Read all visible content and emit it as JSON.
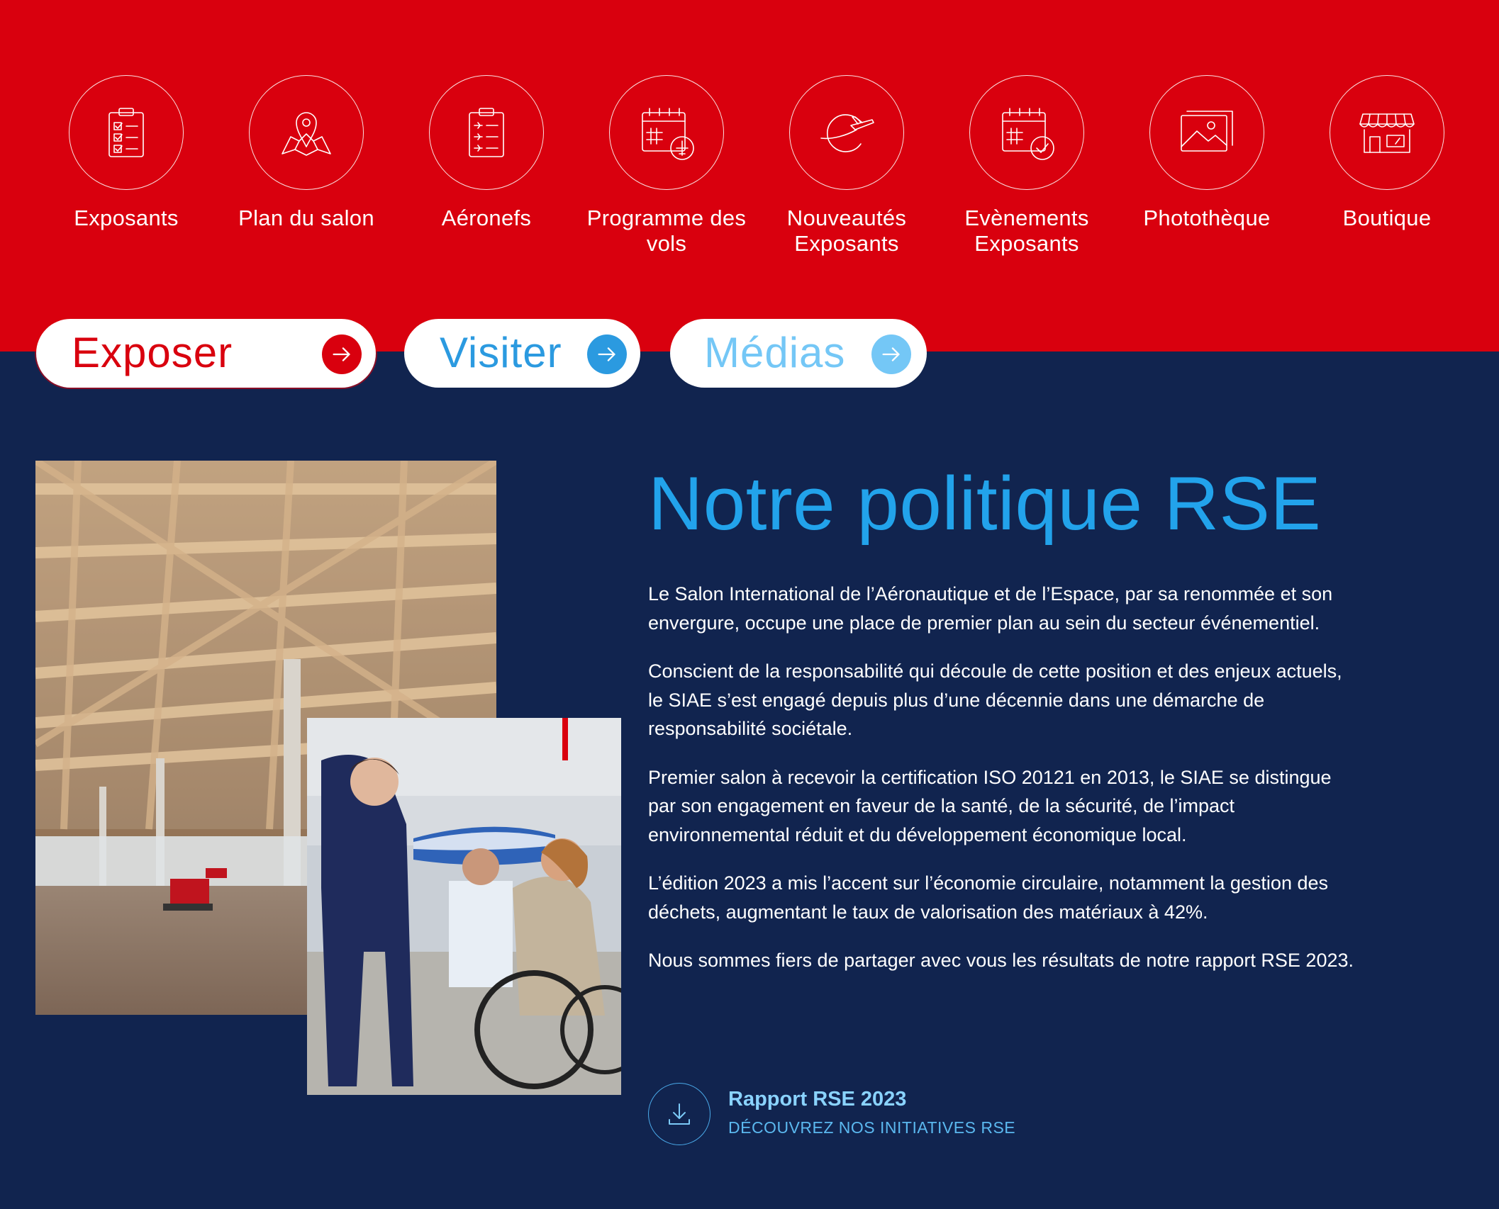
{
  "colors": {
    "top_band": "#d9000e",
    "bottom_band": "#11244f",
    "title_blue": "#22a3eb",
    "link_blue": "#8ad3ff",
    "pill_exposer": "#d9000e",
    "pill_visiter": "#2b9ae0",
    "pill_medias": "#74c7f6"
  },
  "nav": {
    "items": [
      {
        "label": "Exposants",
        "icon": "clipboard-checklist-icon"
      },
      {
        "label": "Plan du salon",
        "icon": "map-pin-icon"
      },
      {
        "label": "Aéronefs",
        "icon": "clipboard-planes-icon"
      },
      {
        "label": "Programme des vols",
        "icon": "calendar-plane-icon"
      },
      {
        "label": "Nouveautés Exposants",
        "icon": "globe-plane-icon"
      },
      {
        "label": "Evènements Exposants",
        "icon": "calendar-check-icon"
      },
      {
        "label": "Photothèque",
        "icon": "image-gallery-icon"
      },
      {
        "label": "Boutique",
        "icon": "storefront-icon"
      }
    ]
  },
  "pills": [
    {
      "label": "Exposer",
      "icon": "arrow-right-icon"
    },
    {
      "label": "Visiter",
      "icon": "arrow-right-icon"
    },
    {
      "label": "Médias",
      "icon": "arrow-right-icon"
    }
  ],
  "photos": {
    "left": "hangar-wood-structure-photo",
    "right": "handshake-wheelchair-photo"
  },
  "rse": {
    "title": "Notre politique RSE",
    "paragraphs": [
      "Le Salon International de l’Aéronautique et de l’Espace, par sa renommée et son envergure, occupe une place de premier plan au sein du secteur événementiel.",
      "Conscient de la responsabilité qui découle de cette position et des enjeux actuels, le SIAE s’est engagé depuis plus d’une décennie dans une démarche de responsabilité sociétale.",
      "Premier salon à recevoir la certification ISO 20121 en 2013, le SIAE se distingue par son engagement en faveur de la santé, de la sécurité, de l’impact environnemental réduit et du développement économique local.",
      "L’édition 2023 a mis l’accent sur l’économie circulaire, notamment la gestion des déchets, augmentant le taux de valorisation des matériaux à 42%.",
      "Nous sommes fiers de partager avec vous les résultats de notre rapport RSE 2023."
    ],
    "download": {
      "title": "Rapport RSE 2023",
      "subtitle": "DÉCOUVREZ NOS INITIATIVES RSE",
      "icon": "download-icon"
    }
  }
}
